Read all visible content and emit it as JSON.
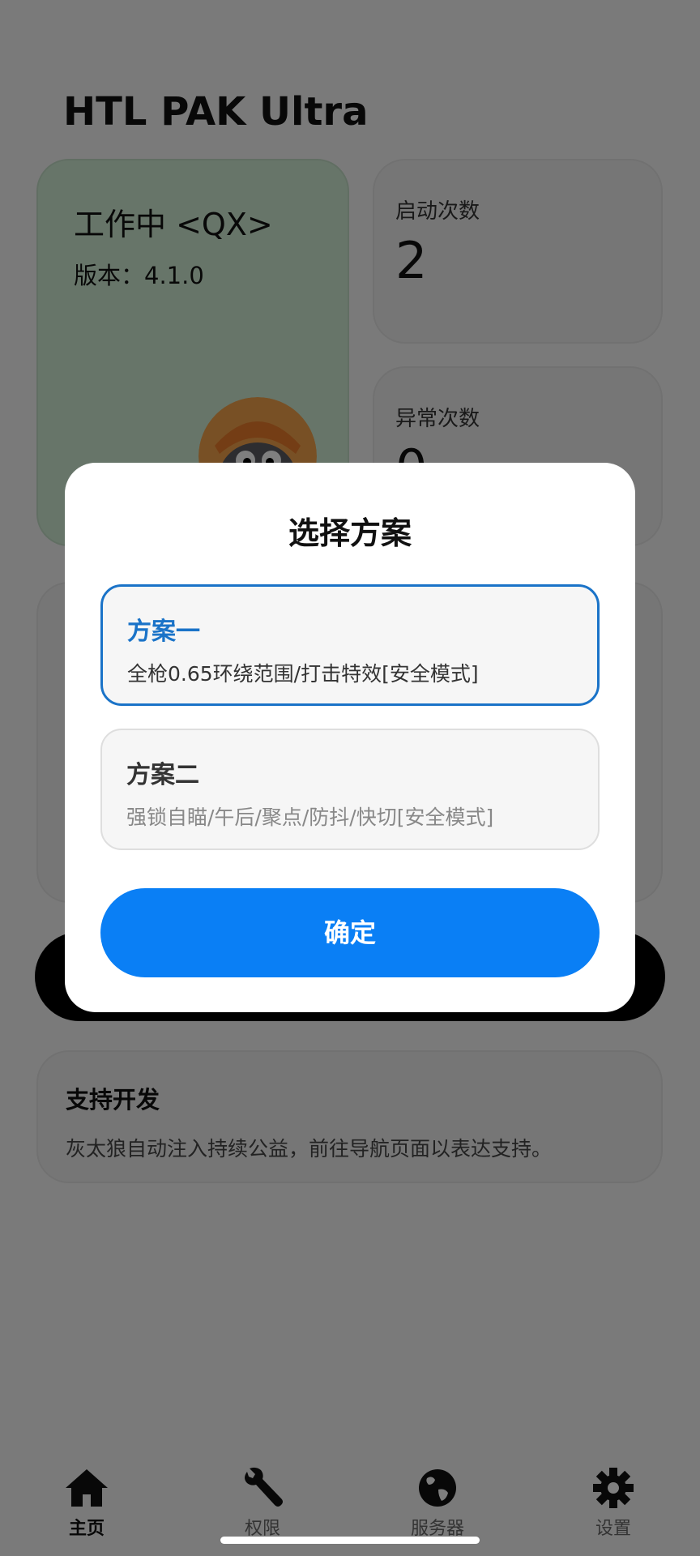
{
  "app": {
    "title": "HTL PAK Ultra"
  },
  "status_card": {
    "title": "工作中 <QX>",
    "version": "版本：4.1.0"
  },
  "stats": {
    "launch": {
      "label": "启动次数",
      "value": "2"
    },
    "error": {
      "label": "异常次数",
      "value": "0"
    }
  },
  "support": {
    "title": "支持开发",
    "text": "灰太狼自动注入持续公益，前往导航页面以表达支持。"
  },
  "dialog": {
    "title": "选择方案",
    "options": [
      {
        "title": "方案一",
        "desc": "全枪0.65环绕范围/打击特效[安全模式]",
        "selected": true
      },
      {
        "title": "方案二",
        "desc": "强锁自瞄/午后/聚点/防抖/快切[安全模式]",
        "selected": false
      }
    ],
    "confirm_label": "确定"
  },
  "nav": {
    "items": [
      {
        "label": "主页",
        "icon": "home-icon",
        "active": true
      },
      {
        "label": "权限",
        "icon": "wrench-icon",
        "active": false
      },
      {
        "label": "服务器",
        "icon": "globe-icon",
        "active": false
      },
      {
        "label": "设置",
        "icon": "gear-icon",
        "active": false
      }
    ]
  },
  "colors": {
    "accent": "#0a7ff5",
    "selected_border": "#1a73c8",
    "status_card_bg": "#cfead2"
  }
}
